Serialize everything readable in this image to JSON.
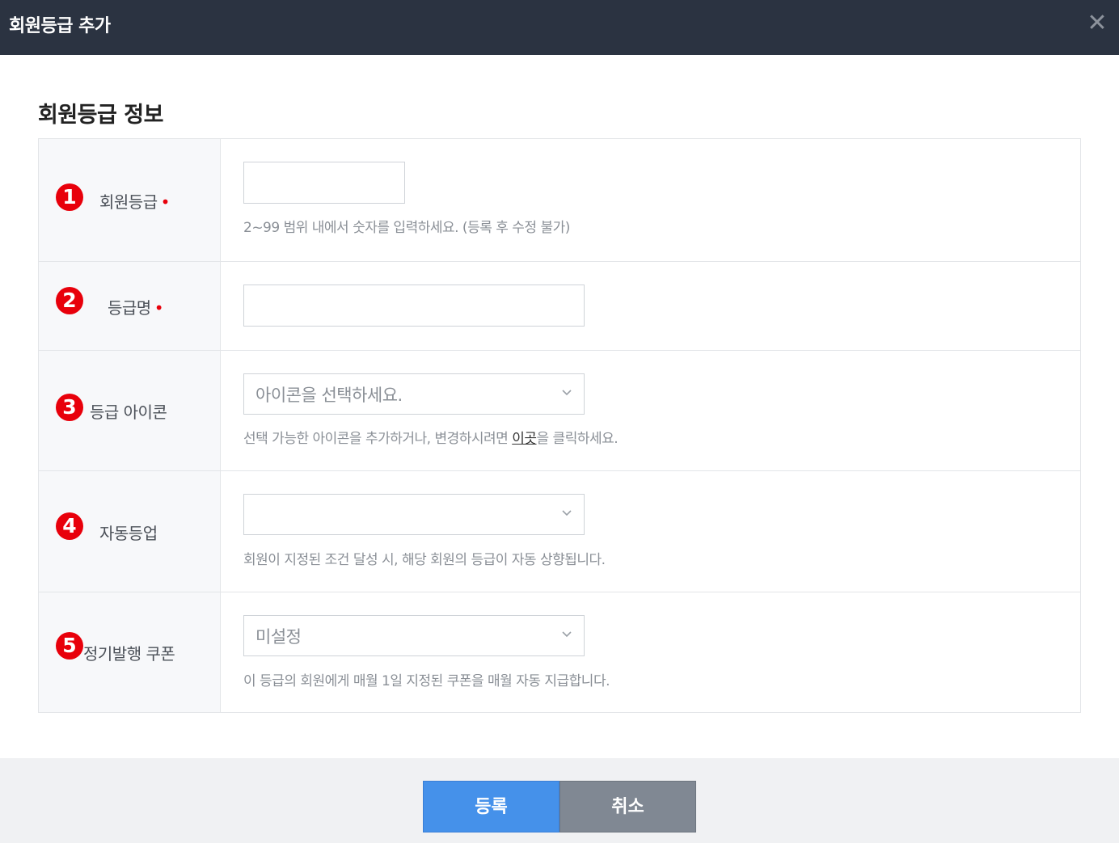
{
  "header": {
    "title": "회원등급 추가",
    "close_symbol": "✕"
  },
  "section": {
    "title": "회원등급 정보"
  },
  "rows": [
    {
      "badge": "1",
      "label": "회원등급",
      "required_mark": "•",
      "input_value": "",
      "help": "2~99 범위 내에서 숫자를 입력하세요. (등록 후 수정 불가)"
    },
    {
      "badge": "2",
      "label": "등급명",
      "required_mark": "•",
      "input_value": ""
    },
    {
      "badge": "3",
      "label": "등급 아이콘",
      "select_value": "아이콘을 선택하세요.",
      "help_prefix": "선택 가능한 아이콘을 추가하거나, 변경하시려면 ",
      "help_link": "이곳",
      "help_suffix": "을 클릭하세요."
    },
    {
      "badge": "4",
      "label": "자동등업",
      "select_value": "",
      "help": "회원이 지정된 조건 달성 시, 해당 회원의 등급이 자동 상향됩니다."
    },
    {
      "badge": "5",
      "label": "정기발행 쿠폰",
      "select_value": "미설정",
      "help": "이 등급의 회원에게 매월 1일 지정된 쿠폰을 매월 자동 지급합니다."
    }
  ],
  "footer": {
    "submit_label": "등록",
    "cancel_label": "취소"
  },
  "colors": {
    "header_bg": "#2b3341",
    "badge_red": "#e8000b",
    "primary_blue": "#4591ea",
    "cancel_gray": "#808893"
  },
  "icons": {
    "close": "close-icon",
    "select_arrow": "chevron-down-icon"
  }
}
